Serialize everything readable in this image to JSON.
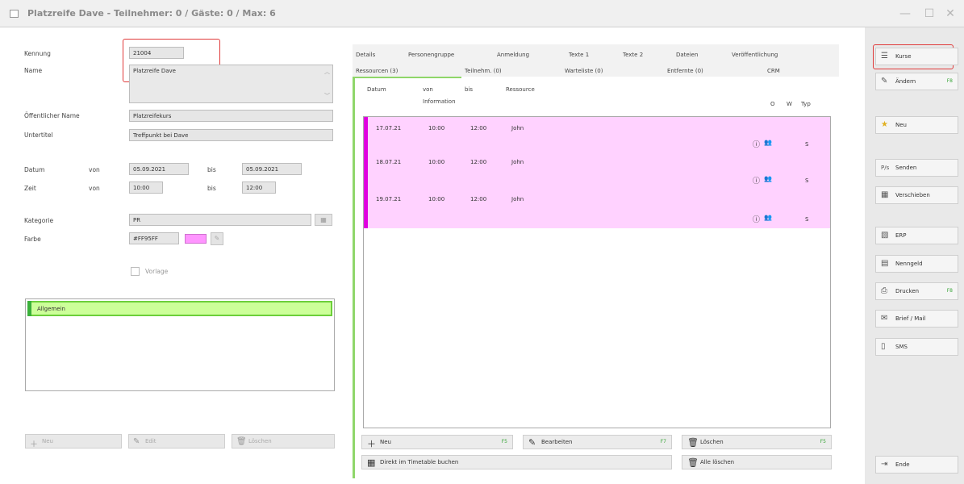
{
  "window": {
    "title": "Platzreife Dave - Teilnehmer: 0 / Gäste: 0 / Max: 6"
  },
  "form": {
    "kennung_label": "Kennung",
    "kennung": "21004",
    "name_label": "Name",
    "name": "Platzreife Dave",
    "oeffentlicher_name_label": "Öffentlicher Name",
    "oeffentlicher_name": "Platzreifekurs",
    "untertitel_label": "Untertitel",
    "untertitel": "Treffpunkt bei Dave",
    "datum_label": "Datum",
    "zeit_label": "Zeit",
    "von": "von",
    "bis": "bis",
    "datum_von": "05.09.2021",
    "datum_bis": "05.09.2021",
    "zeit_von": "10:00",
    "zeit_bis": "12:00",
    "kategorie_label": "Kategorie",
    "kategorie": "PR",
    "farbe_label": "Farbe",
    "farbe": "#FF95FF",
    "farbe_hex": "#ff95ff",
    "vorlage_label": "Vorlage",
    "group_item": "Allgemein",
    "btn_neu": "Neu",
    "btn_edit": "Edit",
    "btn_loeschen": "Löschen"
  },
  "tabs": {
    "row1": [
      "Details",
      "Personengruppe",
      "Anmeldung",
      "Texte 1",
      "Texte 2",
      "Dateien",
      "Veröffentlichung"
    ],
    "row2": [
      "Ressourcen (3)",
      "Teilnehm. (0)",
      "Warteliste (0)",
      "Entfernte (0)",
      "CRM"
    ]
  },
  "table": {
    "headers": {
      "datum": "Datum",
      "von": "von",
      "bis": "bis",
      "ressource": "Ressource",
      "information": "Information",
      "o": "O",
      "w": "W",
      "typ": "Typ"
    },
    "rows": [
      {
        "datum": "17.07.21",
        "von": "10:00",
        "bis": "12:00",
        "ressource": "John",
        "typ": "S"
      },
      {
        "datum": "18.07.21",
        "von": "10:00",
        "bis": "12:00",
        "ressource": "John",
        "typ": "S"
      },
      {
        "datum": "19.07.21",
        "von": "10:00",
        "bis": "12:00",
        "ressource": "John",
        "typ": "S"
      }
    ],
    "row_color": "#ffd2ff",
    "accent_color": "#e000e0"
  },
  "table_actions": {
    "neu": "Neu",
    "neu_key": "F5",
    "bearbeiten": "Bearbeiten",
    "bearbeiten_key": "F7",
    "loeschen": "Löschen",
    "loeschen_key": "F5",
    "direkt": "Direkt im Timetable buchen",
    "alle_loeschen": "Alle löschen"
  },
  "sidebar": {
    "kurse": "Kurse",
    "aendern": "Ändern",
    "aendern_key": "F8",
    "neu": "Neu",
    "senden": "Senden",
    "verschieben": "Verschieben",
    "erp": "ERP",
    "nenngeld": "Nenngeld",
    "drucken": "Drucken",
    "drucken_key": "F8",
    "brief_mail": "Brief / Mail",
    "sms": "SMS",
    "ende": "Ende"
  },
  "colors": {
    "highlight_red": "#e03a3a",
    "group_green": "#ccff99",
    "group_green_border": "#6ccf3a",
    "tab_green": "#8fd66a"
  }
}
